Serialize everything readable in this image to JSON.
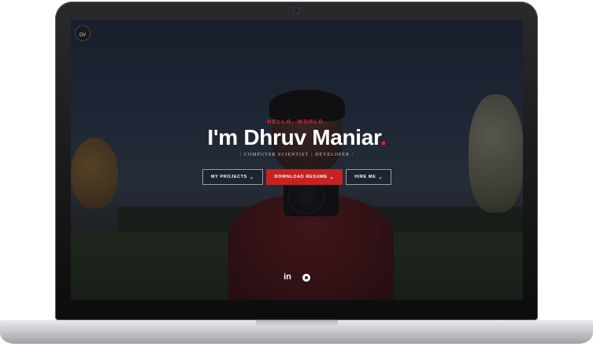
{
  "hero": {
    "logo_text": "DV",
    "greeting": "HELLO, WORLD.",
    "title_prefix": "I'm Dhruv Maniar",
    "title_dot": ".",
    "roles": [
      "COMPUTER SCIENTIST",
      "DEVELOPER"
    ],
    "buttons": [
      {
        "label": "MY PROJECTS",
        "icon": "chevron-down-icon"
      },
      {
        "label": "DOWNLOAD RESUME",
        "icon": "chevron-down-icon"
      },
      {
        "label": "HIRE ME",
        "icon": "chevron-down-icon"
      }
    ]
  },
  "social": {
    "linkedin_label": "in",
    "github_icon": "github-icon"
  },
  "colors": {
    "accent": "#e02b2b",
    "button_primary": "#c62222",
    "overlay": "#0a0c12"
  }
}
